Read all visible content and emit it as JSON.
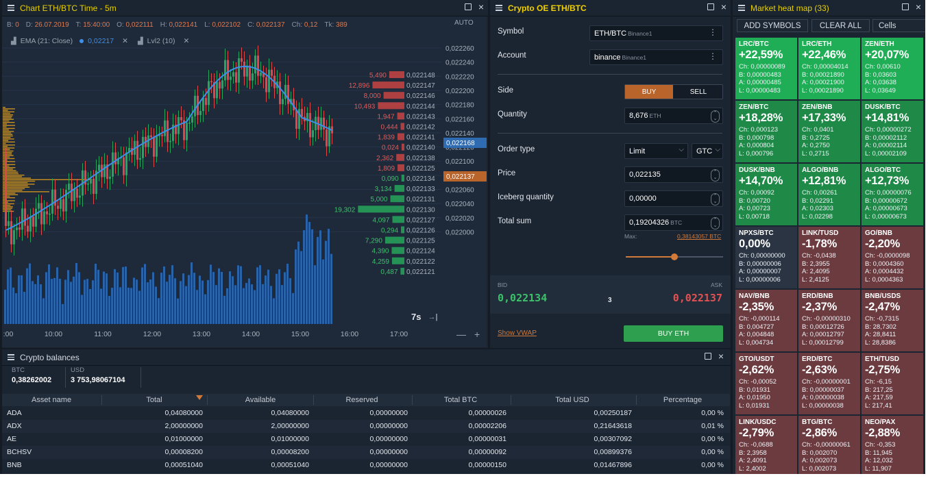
{
  "chart_panel": {
    "title": "Chart ETH/BTC Time - 5m",
    "info": [
      {
        "k": "B:",
        "v": "0"
      },
      {
        "k": "D:",
        "v": "26.07.2019"
      },
      {
        "k": "T:",
        "v": "15:40:00"
      },
      {
        "k": "O:",
        "v": "0,022111"
      },
      {
        "k": "H:",
        "v": "0,022141"
      },
      {
        "k": "L:",
        "v": "0,022102"
      },
      {
        "k": "C:",
        "v": "0,022137"
      },
      {
        "k": "Ch:",
        "v": "0,12"
      },
      {
        "k": "Tk:",
        "v": "389"
      }
    ],
    "auto_label": "AUTO",
    "indicator_ema": "EMA (21: Close)",
    "indicator_ema_value": "0,02217",
    "indicator_lvl2": "Lvl2 (10)",
    "timer": "7s",
    "price_axis": [
      "0,022260",
      "0,022240",
      "0,022220",
      "0,022200",
      "0,022180",
      "0,022160",
      "0,022140",
      "0,022120",
      "0,022100",
      "0,022080",
      "0,022060",
      "0,022040",
      "0,022020",
      "0,022000"
    ],
    "price_marker_ema": "0,022168",
    "price_marker_last": "0,022137",
    "time_axis": [
      ":00",
      "10:00",
      "11:00",
      "12:00",
      "13:00",
      "14:00",
      "15:00",
      "16:00",
      "17:00"
    ],
    "dom_asks": [
      {
        "size": "5,490",
        "price": "0,022148"
      },
      {
        "size": "12,896",
        "price": "0,022147"
      },
      {
        "size": "8,000",
        "price": "0,022146"
      },
      {
        "size": "10,493",
        "price": "0,022144"
      },
      {
        "size": "1,947",
        "price": "0,022143"
      },
      {
        "size": "0,444",
        "price": "0,022142"
      },
      {
        "size": "1,839",
        "price": "0,022141"
      },
      {
        "size": "0,024",
        "price": "0,022140"
      },
      {
        "size": "2,362",
        "price": "0,022138"
      },
      {
        "size": "1,809",
        "price": "0,022125"
      }
    ],
    "dom_bids": [
      {
        "size": "0,090",
        "price": "0,022134"
      },
      {
        "size": "3,134",
        "price": "0,022133"
      },
      {
        "size": "5,000",
        "price": "0,022131"
      },
      {
        "size": "19,302",
        "price": "0,022130"
      },
      {
        "size": "4,097",
        "price": "0,022127"
      },
      {
        "size": "0,294",
        "price": "0,022126"
      },
      {
        "size": "7,290",
        "price": "0,022125"
      },
      {
        "size": "4,390",
        "price": "0,022124"
      },
      {
        "size": "4,259",
        "price": "0,022122"
      },
      {
        "size": "0,487",
        "price": "0,022121"
      }
    ]
  },
  "order_entry": {
    "title": "Crypto OE ETH/BTC",
    "symbol_label": "Symbol",
    "symbol_value": "ETH/BTC",
    "symbol_exchange": "Binance1",
    "account_label": "Account",
    "account_value": "binance",
    "account_exchange": "Binance1",
    "side_label": "Side",
    "buy": "BUY",
    "sell": "SELL",
    "quantity_label": "Quantity",
    "quantity_value": "8,676",
    "quantity_unit": "ETH",
    "order_type_label": "Order type",
    "order_type_value": "Limit",
    "tif_value": "GTC",
    "price_label": "Price",
    "price_value": "0,022135",
    "iceberg_label": "Iceberg quantity",
    "iceberg_value": "0,00000",
    "total_label": "Total sum",
    "total_value": "0,19204326",
    "total_unit": "BTC",
    "max_label": "Max:",
    "max_value": "0,38143057 BTC",
    "slider_fraction": 0.5,
    "bid_label": "BID",
    "ask_label": "ASK",
    "bid_value": "0,022134",
    "ask_value": "0,022137",
    "spread": "3",
    "show_vwap": "Show VWAP",
    "submit": "BUY ETH",
    "colors": {
      "buy": "#b8642a",
      "bid": "#3cc06a",
      "ask": "#e05252",
      "submit": "#2e9e4f"
    }
  },
  "heatmap": {
    "title": "Market heat map (33)",
    "add_symbols": "ADD SYMBOLS",
    "clear_all": "CLEAR ALL",
    "view": "Cells",
    "tiles": [
      {
        "sym": "LRC/BTC",
        "pct": "+22,59%",
        "ch": "Ch: 0,00000089",
        "b": "B: 0,00000483",
        "a": "A: 0,00000485",
        "l": "L: 0,00000483",
        "tone": "up1"
      },
      {
        "sym": "LRC/ETH",
        "pct": "+22,46%",
        "ch": "Ch: 0,00004014",
        "b": "B: 0,00021890",
        "a": "A: 0,00021900",
        "l": "L: 0,00021890",
        "tone": "up1"
      },
      {
        "sym": "ZEN/ETH",
        "pct": "+20,07%",
        "ch": "Ch: 0,00610",
        "b": "B: 0,03603",
        "a": "A: 0,03638",
        "l": "L: 0,03649",
        "tone": "up1"
      },
      {
        "sym": "ZEN/BTC",
        "pct": "+18,28%",
        "ch": "Ch: 0,000123",
        "b": "B: 0,000798",
        "a": "A: 0,000804",
        "l": "L: 0,000796",
        "tone": "up2"
      },
      {
        "sym": "ZEN/BNB",
        "pct": "+17,33%",
        "ch": "Ch: 0,0401",
        "b": "B: 0,2725",
        "a": "A: 0,2750",
        "l": "L: 0,2715",
        "tone": "up2"
      },
      {
        "sym": "DUSK/BTC",
        "pct": "+14,81%",
        "ch": "Ch: 0,00000272",
        "b": "B: 0,00002112",
        "a": "A: 0,00002114",
        "l": "L: 0,00002109",
        "tone": "up2"
      },
      {
        "sym": "DUSK/BNB",
        "pct": "+14,70%",
        "ch": "Ch: 0,00092",
        "b": "B: 0,00720",
        "a": "A: 0,00723",
        "l": "L: 0,00718",
        "tone": "up2"
      },
      {
        "sym": "ALGO/BNB",
        "pct": "+12,81%",
        "ch": "Ch: 0,00261",
        "b": "B: 0,02291",
        "a": "A: 0,02303",
        "l": "L: 0,02298",
        "tone": "up2"
      },
      {
        "sym": "ALGO/BTC",
        "pct": "+12,73%",
        "ch": "Ch: 0,00000076",
        "b": "B: 0,00000672",
        "a": "A: 0,00000673",
        "l": "L: 0,00000673",
        "tone": "up2"
      },
      {
        "sym": "NPXS/BTC",
        "pct": "0,00%",
        "ch": "Ch: 0,00000000",
        "b": "B: 0,00000006",
        "a": "A: 0,00000007",
        "l": "L: 0,00000006",
        "tone": "flat"
      },
      {
        "sym": "LINK/TUSD",
        "pct": "-1,78%",
        "ch": "Ch: -0,0438",
        "b": "B: 2,3955",
        "a": "A: 2,4095",
        "l": "L: 2,4125",
        "tone": "dn"
      },
      {
        "sym": "GO/BNB",
        "pct": "-2,20%",
        "ch": "Ch: -0,0000098",
        "b": "B: 0,0004360",
        "a": "A: 0,0004432",
        "l": "L: 0,0004363",
        "tone": "dn"
      },
      {
        "sym": "NAV/BNB",
        "pct": "-2,35%",
        "ch": "Ch: -0,000114",
        "b": "B: 0,004727",
        "a": "A: 0,004848",
        "l": "L: 0,004734",
        "tone": "dn"
      },
      {
        "sym": "ERD/BNB",
        "pct": "-2,37%",
        "ch": "Ch: -0,00000310",
        "b": "B: 0,00012726",
        "a": "A: 0,00012797",
        "l": "L: 0,00012799",
        "tone": "dn"
      },
      {
        "sym": "BNB/USDS",
        "pct": "-2,47%",
        "ch": "Ch: -0,7315",
        "b": "B: 28,7302",
        "a": "A: 28,8411",
        "l": "L: 28,8386",
        "tone": "dn"
      },
      {
        "sym": "GTO/USDT",
        "pct": "-2,62%",
        "ch": "Ch: -0,00052",
        "b": "B: 0,01931",
        "a": "A: 0,01950",
        "l": "L: 0,01931",
        "tone": "dn"
      },
      {
        "sym": "ERD/BTC",
        "pct": "-2,63%",
        "ch": "Ch: -0,00000001",
        "b": "B: 0,00000037",
        "a": "A: 0,00000038",
        "l": "L: 0,00000038",
        "tone": "dn"
      },
      {
        "sym": "ETH/TUSD",
        "pct": "-2,75%",
        "ch": "Ch: -6,15",
        "b": "B: 217,25",
        "a": "A: 217,59",
        "l": "L: 217,41",
        "tone": "dn"
      },
      {
        "sym": "LINK/USDC",
        "pct": "-2,79%",
        "ch": "Ch: -0,0688",
        "b": "B: 2,3958",
        "a": "A: 2,4091",
        "l": "L: 2,4002",
        "tone": "dn"
      },
      {
        "sym": "BTG/BTC",
        "pct": "-2,86%",
        "ch": "Ch: -0,00000061",
        "b": "B: 0,002070",
        "a": "A: 0,002073",
        "l": "L: 0,002073",
        "tone": "dn"
      },
      {
        "sym": "NEO/PAX",
        "pct": "-2,88%",
        "ch": "Ch: -0,353",
        "b": "B: 11,945",
        "a": "A: 12,032",
        "l": "L: 11,907",
        "tone": "dn"
      }
    ],
    "colors": {
      "up1": "#1fae55",
      "up2": "#1f8a48",
      "flat": "#2a3443",
      "dn": "#6b3b40"
    }
  },
  "balances": {
    "title": "Crypto balances",
    "totals": [
      {
        "k": "BTC",
        "v": "0,38262002"
      },
      {
        "k": "USD",
        "v": "3 753,98067104"
      }
    ],
    "columns": [
      "Asset name",
      "Total",
      "Available",
      "Reserved",
      "Total BTC",
      "Total USD",
      "Percentage"
    ],
    "rows": [
      [
        "ADA",
        "0,04080000",
        "0,04080000",
        "0,00000000",
        "0,00000026",
        "0,00250187",
        "0,00 %"
      ],
      [
        "ADX",
        "2,00000000",
        "2,00000000",
        "0,00000000",
        "0,00002206",
        "0,21643618",
        "0,01 %"
      ],
      [
        "AE",
        "0,01000000",
        "0,01000000",
        "0,00000000",
        "0,00000031",
        "0,00307092",
        "0,00 %"
      ],
      [
        "BCHSV",
        "0,00008200",
        "0,00008200",
        "0,00000000",
        "0,00000092",
        "0,00899376",
        "0,00 %"
      ],
      [
        "BNB",
        "0,00051040",
        "0,00051040",
        "0,00000000",
        "0,00000150",
        "0,01467896",
        "0,00 %"
      ]
    ]
  }
}
